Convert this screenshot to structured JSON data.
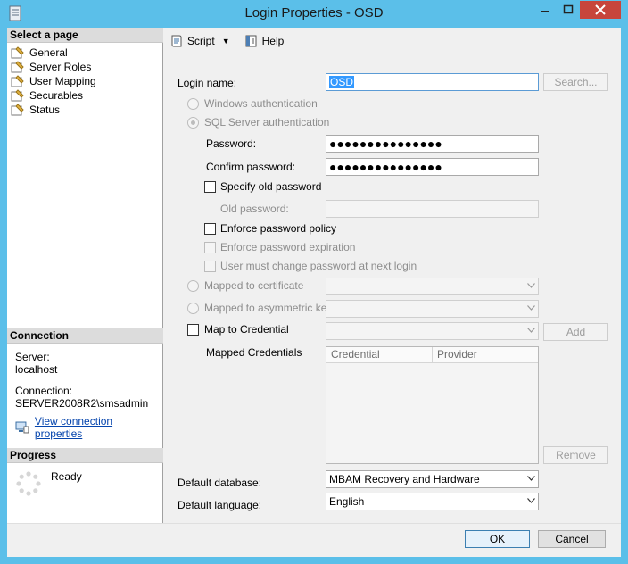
{
  "window": {
    "title": "Login Properties - OSD",
    "controls": [
      "minimize-icon",
      "maximize-icon",
      "close-icon"
    ]
  },
  "left_pane": {
    "select_page_header": "Select a page",
    "pages": [
      {
        "label": "General",
        "icon": "wrench-page-icon"
      },
      {
        "label": "Server Roles",
        "icon": "wrench-page-icon"
      },
      {
        "label": "User Mapping",
        "icon": "wrench-page-icon"
      },
      {
        "label": "Securables",
        "icon": "wrench-page-icon"
      },
      {
        "label": "Status",
        "icon": "wrench-page-icon"
      }
    ],
    "connection_header": "Connection",
    "server_label": "Server:",
    "server_value": "localhost",
    "connection_label": "Connection:",
    "connection_value": "SERVER2008R2\\smsadmin",
    "view_connection_link": "View connection properties",
    "progress_header": "Progress",
    "progress_status": "Ready"
  },
  "toolbar": {
    "script_label": "Script",
    "help_label": "Help"
  },
  "form": {
    "login_name_label": "Login name:",
    "login_name_value": "OSD",
    "search_button": "Search...",
    "windows_auth_label": "Windows authentication",
    "sql_auth_label": "SQL Server authentication",
    "password_label": "Password:",
    "password_value": "●●●●●●●●●●●●●●●",
    "confirm_password_label": "Confirm password:",
    "confirm_password_value": "●●●●●●●●●●●●●●●",
    "specify_old_password_label": "Specify old password",
    "old_password_label": "Old password:",
    "enforce_policy_label": "Enforce password policy",
    "enforce_expiration_label": "Enforce password expiration",
    "must_change_label": "User must change password at next login",
    "mapped_cert_label": "Mapped to certificate",
    "mapped_asym_label": "Mapped to asymmetric key",
    "map_credential_label": "Map to Credential",
    "add_button": "Add",
    "mapped_credentials_label": "Mapped Credentials",
    "credentials_columns": [
      "Credential",
      "Provider"
    ],
    "remove_button": "Remove",
    "default_database_label": "Default database:",
    "default_database_value": "MBAM Recovery and Hardware",
    "default_language_label": "Default language:",
    "default_language_value": "English"
  },
  "buttons": {
    "ok": "OK",
    "cancel": "Cancel"
  }
}
